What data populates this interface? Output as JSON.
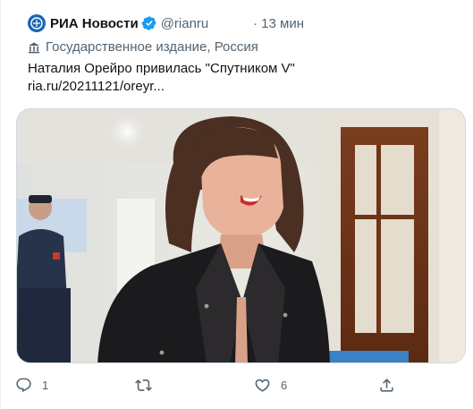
{
  "tweet": {
    "author_name": "РИА Новости",
    "author_handle": "@rianru",
    "time": "· 13 мин",
    "account_label": "Государственное издание, Россия",
    "text_line1": "Наталия Орейро привилась \"Спутником V\"",
    "text_line2": "ria.ru/20211121/oreyr..."
  },
  "actions": {
    "reply_count": "1",
    "retweet_count": "",
    "like_count": "6",
    "share_count": ""
  },
  "colors": {
    "text": "#0f1419",
    "secondary": "#536471",
    "verified": "#1d9bf0",
    "avatar": "#1967b3"
  },
  "icons": {
    "avatar": "ria-logo-icon",
    "verified": "verified-badge-icon",
    "label": "government-building-icon",
    "reply": "reply-icon",
    "retweet": "retweet-icon",
    "like": "heart-icon",
    "share": "share-icon"
  }
}
